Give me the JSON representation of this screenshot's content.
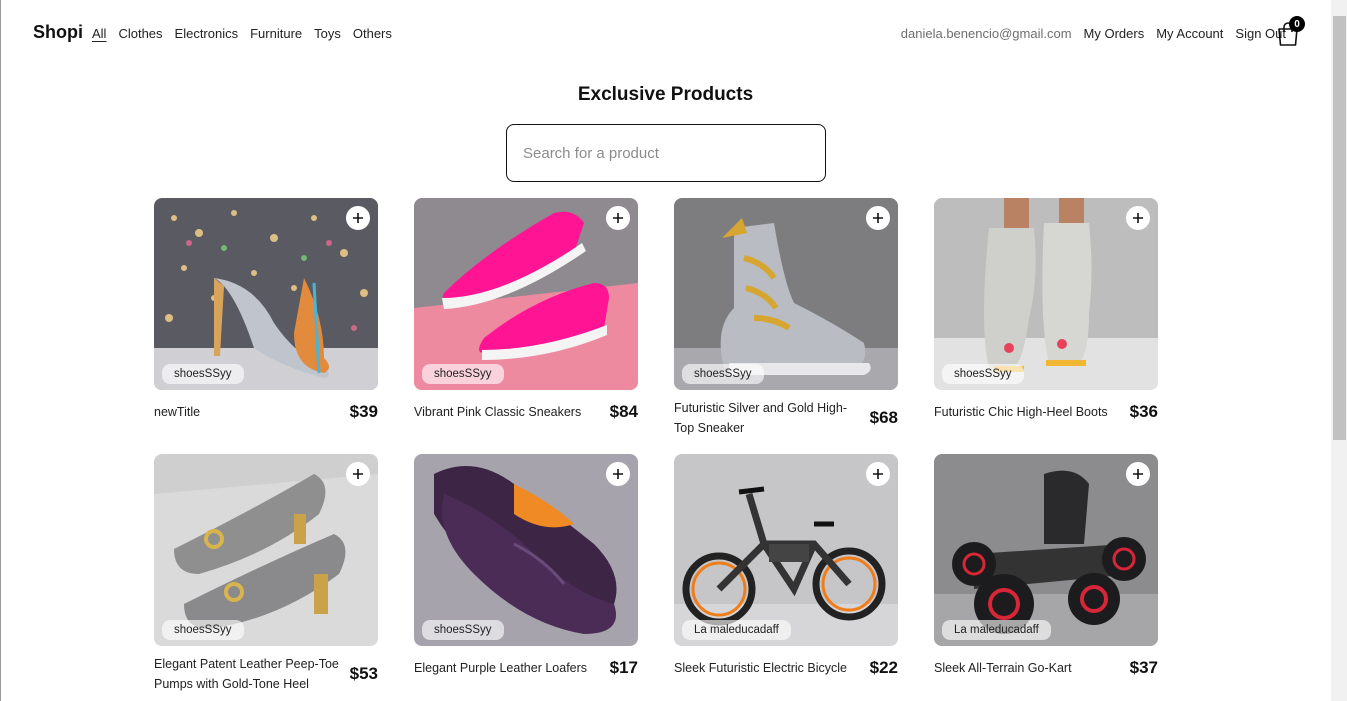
{
  "brand": "Shopi",
  "nav": {
    "categories": [
      "All",
      "Clothes",
      "Electronics",
      "Furniture",
      "Toys",
      "Others"
    ],
    "active": "All",
    "email": "daniela.benencio@gmail.com",
    "my_orders": "My Orders",
    "my_account": "My Account",
    "sign_out": "Sign Out",
    "cart_count": "0"
  },
  "page_title": "Exclusive Products",
  "search": {
    "placeholder": "Search for a product",
    "value": ""
  },
  "products": [
    {
      "name": "newTitle",
      "price": "$39",
      "category": "shoesSSyy",
      "image": "glitter-high-heels"
    },
    {
      "name": "Vibrant Pink Classic Sneakers",
      "price": "$84",
      "category": "shoesSSyy",
      "image": "pink-sneakers"
    },
    {
      "name": "Futuristic Silver and Gold High-Top Sneaker",
      "price": "$68",
      "category": "shoesSSyy",
      "image": "silver-gold-boot"
    },
    {
      "name": "Futuristic Chic High-Heel Boots",
      "price": "$36",
      "category": "shoesSSyy",
      "image": "grey-heel-boots"
    },
    {
      "name": "Elegant Patent Leather Peep-Toe Pumps with Gold-Tone Heel",
      "price": "$53",
      "category": "shoesSSyy",
      "image": "grey-peep-toe-pumps"
    },
    {
      "name": "Elegant Purple Leather Loafers",
      "price": "$17",
      "category": "shoesSSyy",
      "image": "purple-loafers"
    },
    {
      "name": "Sleek Futuristic Electric Bicycle",
      "price": "$22",
      "category": "La maleducadaff",
      "image": "electric-bicycle"
    },
    {
      "name": "Sleek All-Terrain Go-Kart",
      "price": "$37",
      "category": "La maleducadaff",
      "image": "go-kart"
    }
  ],
  "colors": {
    "text": "#222222",
    "muted": "#6e6e6e",
    "border": "#111111",
    "badge": "#000000"
  }
}
